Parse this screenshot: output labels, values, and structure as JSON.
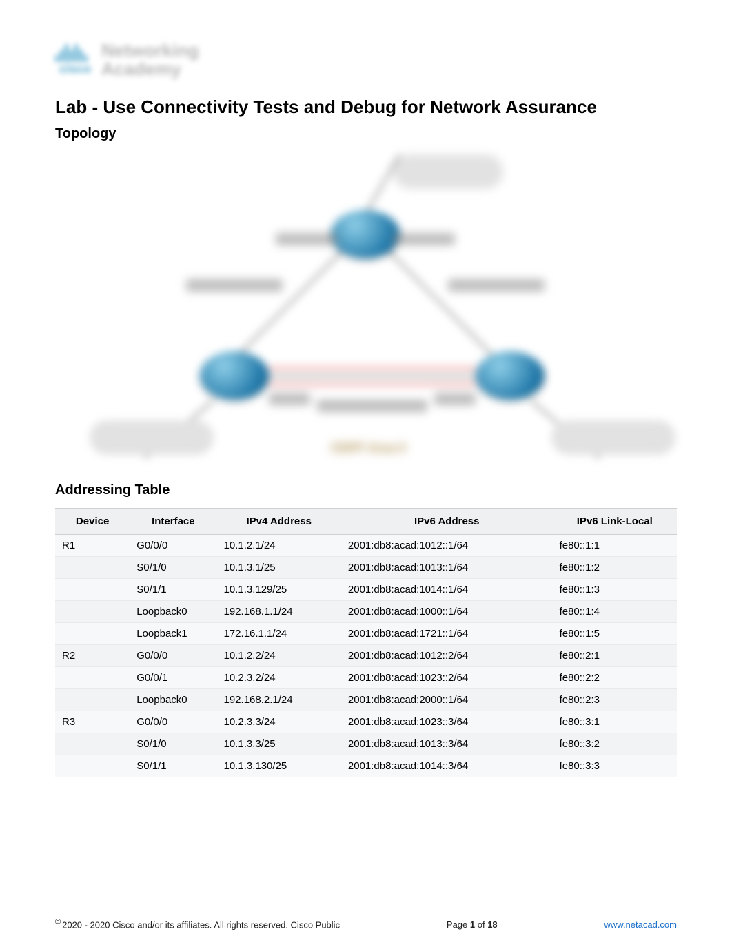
{
  "header": {
    "brand_line1": "Networking",
    "brand_line2": "Academy",
    "cisco_word": "cisco"
  },
  "title": "Lab - Use Connectivity Tests and Debug for Network Assurance",
  "section_topology": "Topology",
  "section_addressing": "Addressing Table",
  "topology_area_label": "OSPF Area 0",
  "table": {
    "headers": {
      "device": "Device",
      "interface": "Interface",
      "ipv4": "IPv4 Address",
      "ipv6": "IPv6 Address",
      "ipv6ll": "IPv6 Link-Local"
    },
    "rows": [
      {
        "device": "R1",
        "interface": "G0/0/0",
        "ipv4": "10.1.2.1/24",
        "ipv6": "2001:db8:acad:1012::1/64",
        "ll": "fe80::1:1"
      },
      {
        "device": "",
        "interface": "S0/1/0",
        "ipv4": "10.1.3.1/25",
        "ipv6": "2001:db8:acad:1013::1/64",
        "ll": "fe80::1:2"
      },
      {
        "device": "",
        "interface": "S0/1/1",
        "ipv4": "10.1.3.129/25",
        "ipv6": "2001:db8:acad:1014::1/64",
        "ll": "fe80::1:3"
      },
      {
        "device": "",
        "interface": "Loopback0",
        "ipv4": "192.168.1.1/24",
        "ipv6": "2001:db8:acad:1000::1/64",
        "ll": "fe80::1:4"
      },
      {
        "device": "",
        "interface": "Loopback1",
        "ipv4": "172.16.1.1/24",
        "ipv6": "2001:db8:acad:1721::1/64",
        "ll": "fe80::1:5"
      },
      {
        "device": "R2",
        "interface": "G0/0/0",
        "ipv4": "10.1.2.2/24",
        "ipv6": "2001:db8:acad:1012::2/64",
        "ll": "fe80::2:1"
      },
      {
        "device": "",
        "interface": "G0/0/1",
        "ipv4": "10.2.3.2/24",
        "ipv6": "2001:db8:acad:1023::2/64",
        "ll": "fe80::2:2"
      },
      {
        "device": "",
        "interface": "Loopback0",
        "ipv4": "192.168.2.1/24",
        "ipv6": "2001:db8:acad:2000::1/64",
        "ll": "fe80::2:3"
      },
      {
        "device": "R3",
        "interface": "G0/0/0",
        "ipv4": "10.2.3.3/24",
        "ipv6": "2001:db8:acad:1023::3/64",
        "ll": "fe80::3:1"
      },
      {
        "device": "",
        "interface": "S0/1/0",
        "ipv4": "10.1.3.3/25",
        "ipv6": "2001:db8:acad:1013::3/64",
        "ll": "fe80::3:2"
      },
      {
        "device": "",
        "interface": "S0/1/1",
        "ipv4": "10.1.3.130/25",
        "ipv6": "2001:db8:acad:1014::3/64",
        "ll": "fe80::3:3"
      }
    ]
  },
  "footer": {
    "copyright": "2020 - 2020 Cisco and/or its affiliates. All rights reserved. Cisco Public",
    "page_label_pre": "Page ",
    "page_current": "1",
    "page_mid": " of ",
    "page_total": "18",
    "url": "www.netacad.com"
  }
}
